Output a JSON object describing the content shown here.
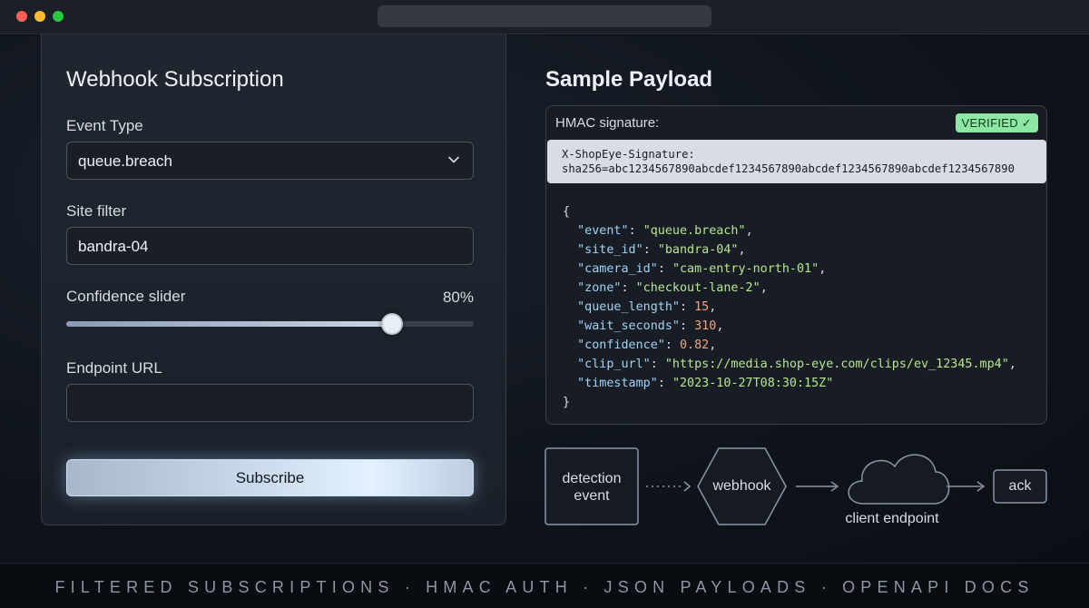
{
  "form": {
    "title": "Webhook Subscription",
    "event_type": {
      "label": "Event Type",
      "value": "queue.breach"
    },
    "site_filter": {
      "label": "Site filter",
      "value": "bandra-04"
    },
    "confidence": {
      "label": "Confidence slider",
      "value_text": "80%",
      "value": 0.8
    },
    "endpoint": {
      "label": "Endpoint URL",
      "value": ""
    },
    "subscribe_label": "Subscribe"
  },
  "payload": {
    "title": "Sample Payload",
    "hmac_label": "HMAC signature:",
    "verified_label": "VERIFIED ✓",
    "signature_header": "X-ShopEye-Signature:",
    "signature_value": "sha256=abc1234567890abcdef1234567890abcdef1234567890abcdef1234567890",
    "open_brace": "{",
    "close_brace": "}",
    "fields": [
      {
        "key": "\"event\"",
        "value": "\"queue.breach\"",
        "kind": "string"
      },
      {
        "key": "\"site_id\"",
        "value": "\"bandra-04\"",
        "kind": "string"
      },
      {
        "key": "\"camera_id\"",
        "value": "\"cam-entry-north-01\"",
        "kind": "string"
      },
      {
        "key": "\"zone\"",
        "value": "\"checkout-lane-2\"",
        "kind": "string"
      },
      {
        "key": "\"queue_length\"",
        "value": "15",
        "kind": "number"
      },
      {
        "key": "\"wait_seconds\"",
        "value": "310",
        "kind": "number"
      },
      {
        "key": "\"confidence\"",
        "value": "0.82",
        "kind": "number"
      },
      {
        "key": "\"clip_url\"",
        "value": "\"https://media.shop-eye.com/clips/ev_12345.mp4\"",
        "kind": "string"
      },
      {
        "key": "\"timestamp\"",
        "value": "\"2023-10-27T08:30:15Z\"",
        "kind": "string"
      }
    ]
  },
  "flow": {
    "detection_line1": "detection",
    "detection_line2": "event",
    "webhook": "webhook",
    "client_endpoint": "client endpoint",
    "ack": "ack"
  },
  "footer": {
    "text": "FILTERED SUBSCRIPTIONS · HMAC AUTH · JSON PAYLOADS · OPENAPI DOCS"
  },
  "colors": {
    "verified_badge": "#8ee6a4",
    "json_key": "#9fd3f7",
    "json_string": "#b8e68f",
    "json_number": "#f5a37a"
  }
}
